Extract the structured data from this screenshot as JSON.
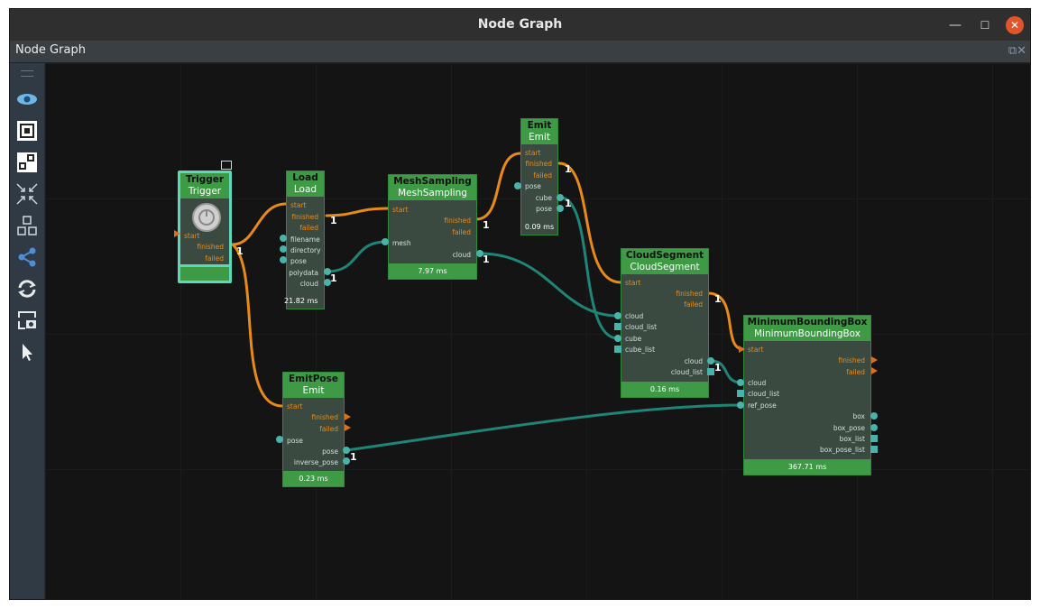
{
  "window": {
    "title": "Node Graph",
    "min_label": "—",
    "max_label": "☐",
    "close_label": "✕"
  },
  "panel": {
    "title": "Node Graph",
    "icons": "⧉✕"
  },
  "toolbar": [
    "eye-icon",
    "frame-select-icon",
    "fit-icon",
    "collapse-icon",
    "layout-icon",
    "graph-icon",
    "refresh-icon",
    "screenshot-icon",
    "pointer-icon"
  ],
  "colors": {
    "accent": "#3f9a46",
    "wire_exec": "#e88a1a",
    "wire_data": "#1f8577",
    "port": "#48b3a8",
    "trigger_border": "#5dd8b8"
  },
  "nodes": {
    "trigger": {
      "title": "Trigger",
      "subtitle": "Trigger",
      "start": "start",
      "finished": "finished",
      "failed": "failed",
      "count": "1"
    },
    "load": {
      "title": "Load",
      "subtitle": "Load",
      "start": "start",
      "finished": "finished",
      "failed": "failed",
      "filename": "filename",
      "directory": "directory",
      "pose": "pose",
      "polydata": "polydata",
      "cloud": "cloud",
      "time": "21.82 ms",
      "count1": "1",
      "count2": "1"
    },
    "mesh": {
      "title": "MeshSampling",
      "subtitle": "MeshSampling",
      "start": "start",
      "finished": "finished",
      "failed": "failed",
      "mesh": "mesh",
      "cloud": "cloud",
      "time": "7.97 ms",
      "count1": "1",
      "count2": "1"
    },
    "emit": {
      "title": "Emit",
      "subtitle": "Emit",
      "start": "start",
      "finished": "finished",
      "failed": "failed",
      "pose": "pose",
      "cube": "cube",
      "pose_out": "pose",
      "time": "0.09 ms",
      "count1": "1",
      "count2": "1"
    },
    "emitpose": {
      "title": "EmitPose",
      "subtitle": "Emit",
      "start": "start",
      "finished": "finished",
      "failed": "failed",
      "pose": "pose",
      "pose_out": "pose",
      "inverse_pose": "inverse_pose",
      "time": "0.23 ms",
      "count": "1"
    },
    "cloudseg": {
      "title": "CloudSegment",
      "subtitle": "CloudSegment",
      "start": "start",
      "finished": "finished",
      "failed": "failed",
      "cloud": "cloud",
      "cloud_list": "cloud_list",
      "cube": "cube",
      "cube_list": "cube_list",
      "cloud_out": "cloud",
      "cloud_list_out": "cloud_list",
      "time": "0.16 ms",
      "count1": "1",
      "count2": "1"
    },
    "mbb": {
      "title": "MinimumBoundingBox",
      "subtitle": "MinimumBoundingBox",
      "start": "start",
      "finished": "finished",
      "failed": "failed",
      "cloud": "cloud",
      "cloud_list": "cloud_list",
      "ref_pose": "ref_pose",
      "box": "box",
      "box_pose": "box_pose",
      "box_list": "box_list",
      "box_pose_list": "box_pose_list",
      "time": "367.71 ms"
    }
  }
}
